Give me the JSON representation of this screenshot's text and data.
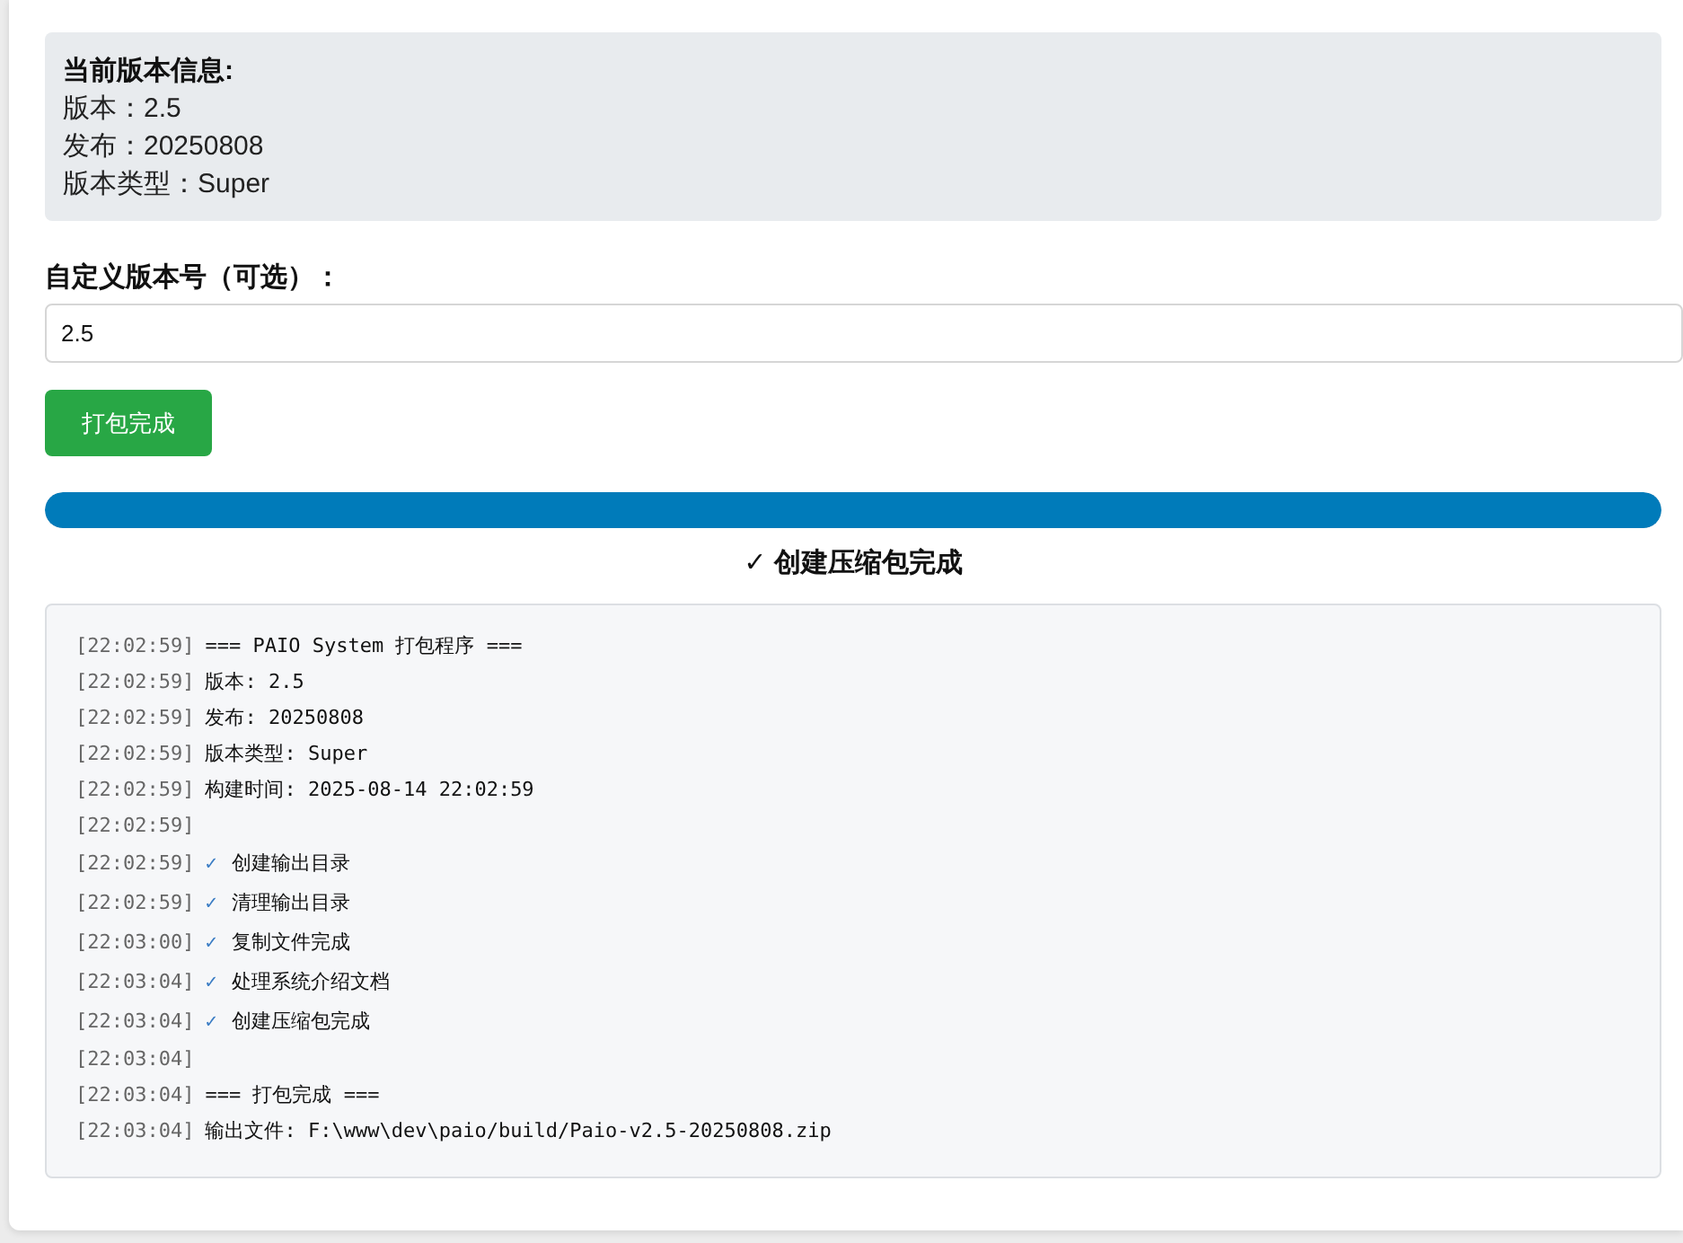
{
  "info": {
    "title": "当前版本信息:",
    "lines": [
      "版本：2.5",
      "发布：20250808",
      "版本类型：Super"
    ]
  },
  "custom_version": {
    "label": "自定义版本号（可选）：",
    "value": "2.5"
  },
  "button": {
    "label": "打包完成"
  },
  "progress": {
    "level": 1
  },
  "status": "✓ 创建压缩包完成",
  "log": [
    {
      "time": "[22:02:59]",
      "kind": "plain",
      "text": "=== PAIO System 打包程序 ==="
    },
    {
      "time": "[22:02:59]",
      "kind": "plain",
      "text": "版本: 2.5"
    },
    {
      "time": "[22:02:59]",
      "kind": "plain",
      "text": "发布: 20250808"
    },
    {
      "time": "[22:02:59]",
      "kind": "plain",
      "text": "版本类型: Super"
    },
    {
      "time": "[22:02:59]",
      "kind": "plain",
      "text": "构建时间: 2025-08-14 22:02:59"
    },
    {
      "time": "[22:02:59]",
      "kind": "blank"
    },
    {
      "time": "[22:02:59]",
      "kind": "check",
      "mark": "✓",
      "text": "创建输出目录"
    },
    {
      "time": "[22:02:59]",
      "kind": "check",
      "mark": "✓",
      "text": "清理输出目录"
    },
    {
      "time": "[22:03:00]",
      "kind": "check",
      "mark": "✓",
      "text": "复制文件完成"
    },
    {
      "time": "[22:03:04]",
      "kind": "check",
      "mark": "✓",
      "text": "处理系统介绍文档"
    },
    {
      "time": "[22:03:04]",
      "kind": "check",
      "mark": "✓",
      "text": "创建压缩包完成"
    },
    {
      "time": "[22:03:04]",
      "kind": "blank"
    },
    {
      "time": "[22:03:04]",
      "kind": "plain",
      "text": "=== 打包完成 ==="
    },
    {
      "time": "[22:03:04]",
      "kind": "plain",
      "text": "输出文件: F:\\www\\dev\\paio/build/Paio-v2.5-20250808.zip"
    }
  ]
}
